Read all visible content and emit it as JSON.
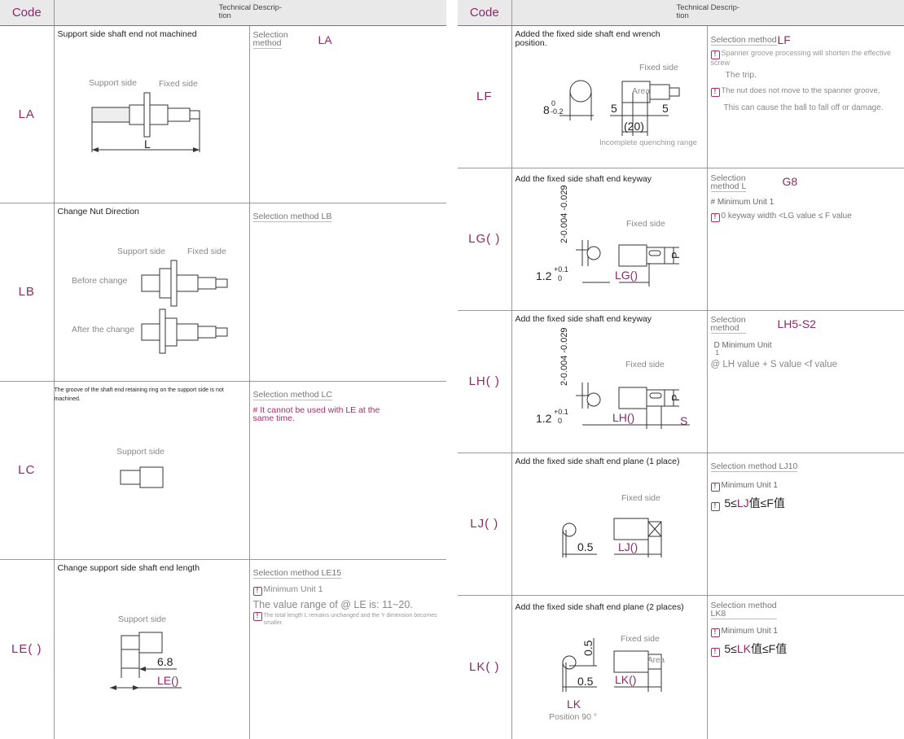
{
  "header": {
    "code": "Code",
    "desc_line1": "Technical Descrip-",
    "desc_line2": "tion"
  },
  "left": {
    "LA": {
      "code": "LA",
      "desc": "Support side shaft end not machined",
      "support": "Support side",
      "fixed": "Fixed side",
      "L": "L",
      "sel_title_1": "Selection",
      "sel_title_2": "method",
      "sel_value": "LA"
    },
    "LB": {
      "code": "LB",
      "desc": "Change Nut Direction",
      "support": "Support side",
      "fixed": "Fixed side",
      "before": "Before change",
      "after": "After the change",
      "sel_title": "Selection method LB"
    },
    "LC": {
      "code": "LC",
      "desc": "The groove of the shaft end retaining ring on the support side is not machined.",
      "support": "Support side",
      "sel_title": "Selection method LC",
      "note": "# It cannot be used with LE at the same time."
    },
    "LE": {
      "code": "LE( )",
      "desc": "Change support side shaft end length",
      "support": "Support side",
      "dim": "6.8",
      "dim_label": "LE()",
      "sel_title": "Selection method LE15",
      "note1": "Minimum Unit 1",
      "note2": "The value range of @ LE is: 11~20.",
      "note3": "The total length L remains unchanged and the Y dimension becomes smaller."
    }
  },
  "right": {
    "LF": {
      "code": "LF",
      "desc": "Added the fixed side shaft end wrench position.",
      "fixed": "Fixed side",
      "area": "Area",
      "d1": "8",
      "d1_sup": "0",
      "d1_sub": "-0.2",
      "d2": "5",
      "d3": "5",
      "d4": "(20)",
      "incomplete": "Incomplete quenching range",
      "sel_title": "Selection method",
      "sel_value": "LF",
      "note1": "Spanner groove processing will shorten the effective screw",
      "note1b": "The trip.",
      "note2": "The nut does not move to the spanner groove,",
      "note2b": "This can cause the ball to fall off or damage."
    },
    "LG": {
      "code": "LG( )",
      "desc": "Add the fixed side shaft end keyway",
      "fixed": "Fixed side",
      "tol": "2-0.004 -0.029",
      "w": "1.2",
      "w_sup": "+0.1",
      "w_sub": "0",
      "lg": "LG()",
      "p": "P",
      "sel_title_1": "Selection",
      "sel_title_2": "method L",
      "sel_value": "G8",
      "note1": "# Minimum Unit 1",
      "note2": "0 keyway width <LG value ≤ F value"
    },
    "LH": {
      "code": "LH( )",
      "desc": "Add the fixed side shaft end keyway",
      "fixed": "Fixed side",
      "tol": "2-0.004 -0.029",
      "w": "1.2",
      "w_sup": "+0.1",
      "w_sub": "0",
      "lh": "LH()",
      "p": "P",
      "s": "S",
      "sel_title_1": "Selection",
      "sel_title_2": "method",
      "sel_value": "LH5-S2",
      "note1": "D Minimum Unit",
      "note1b": "1",
      "note2": "@ LH value + S value <f value"
    },
    "LJ": {
      "code": "LJ( )",
      "desc": "Add the fixed side shaft end plane (1 place)",
      "fixed": "Fixed side",
      "dim": "0.5",
      "lj": "LJ()",
      "sel_title": "Selection method LJ10",
      "note1": "Minimum Unit 1",
      "note2_pre": "5≤",
      "note2_pk": "LJ",
      "note2_post": "值≤F值"
    },
    "LK": {
      "code": "LK( )",
      "desc": "Add the fixed side shaft end plane (2 places)",
      "fixed": "Fixed side",
      "area": "Area",
      "dim_v": "0.5",
      "dim_h": "0.5",
      "lk": "LK()",
      "lk2": "LK",
      "position": "Position 90 °",
      "sel_title_1": "Selection method",
      "sel_title_2": "LK8",
      "note1": "Minimum Unit 1",
      "note2_pre": "5≤",
      "note2_pk": "LK",
      "note2_post": "值≤F值"
    }
  },
  "icons": {
    "warning": "exclamation-box-icon"
  },
  "colors": {
    "accent": "#8a2a6a",
    "header_bg": "#e9e9e9"
  }
}
